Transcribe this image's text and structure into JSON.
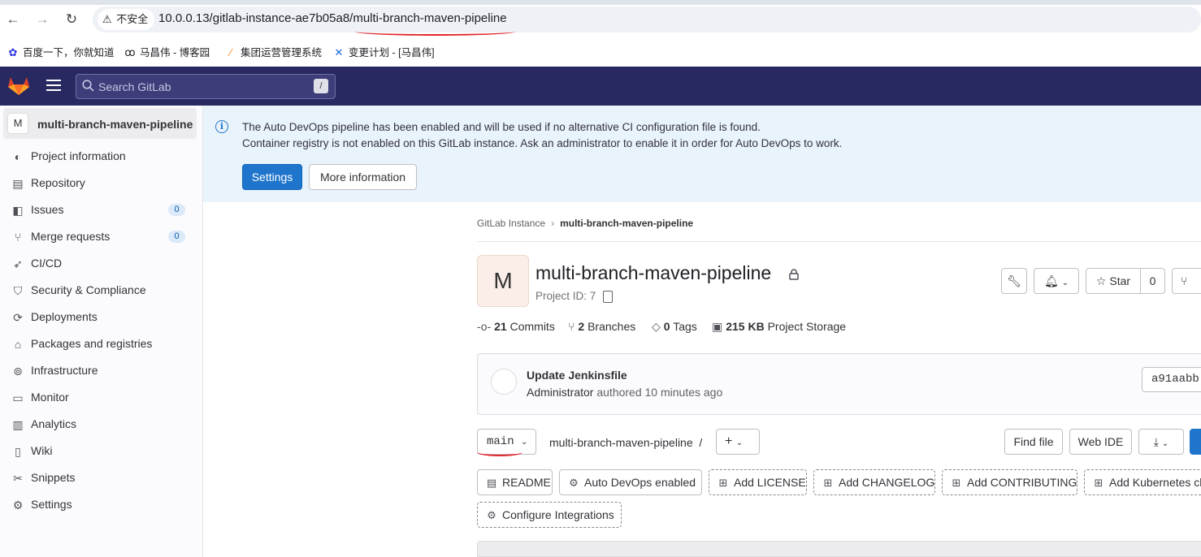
{
  "browser": {
    "insecure_label": "不安全",
    "url": "10.0.0.13/gitlab-instance-ae7b05a8/multi-branch-maven-pipeline",
    "bookmarks": [
      {
        "label": "百度一下，你就知道",
        "icon": "baidu-paw-icon"
      },
      {
        "label": "马昌伟 - 博客园",
        "icon": "blog-icon"
      },
      {
        "label": "集团运营管理系统",
        "icon": "ops-system-icon"
      },
      {
        "label": "变更计划 - [马昌伟]",
        "icon": "confluence-icon"
      }
    ]
  },
  "header": {
    "search_placeholder": "Search GitLab",
    "search_shortcut": "/"
  },
  "sidebar": {
    "project_avatar_letter": "M",
    "project_name": "multi-branch-maven-pipeline",
    "items": [
      {
        "label": "Project information",
        "icon": "project-info-icon"
      },
      {
        "label": "Repository",
        "icon": "document-icon"
      },
      {
        "label": "Issues",
        "icon": "issues-icon",
        "count": "0"
      },
      {
        "label": "Merge requests",
        "icon": "merge-request-icon",
        "count": "0"
      },
      {
        "label": "CI/CD",
        "icon": "rocket-icon"
      },
      {
        "label": "Security & Compliance",
        "icon": "shield-icon"
      },
      {
        "label": "Deployments",
        "icon": "deployments-icon"
      },
      {
        "label": "Packages and registries",
        "icon": "package-icon"
      },
      {
        "label": "Infrastructure",
        "icon": "infrastructure-icon"
      },
      {
        "label": "Monitor",
        "icon": "monitor-icon"
      },
      {
        "label": "Analytics",
        "icon": "chart-icon"
      },
      {
        "label": "Wiki",
        "icon": "book-icon"
      },
      {
        "label": "Snippets",
        "icon": "snippet-icon"
      },
      {
        "label": "Settings",
        "icon": "gear-icon"
      }
    ]
  },
  "alert": {
    "line1": "The Auto DevOps pipeline has been enabled and will be used if no alternative CI configuration file is found.",
    "line2": "Container registry is not enabled on this GitLab instance. Ask an administrator to enable it in order for Auto DevOps to work.",
    "settings_button": "Settings",
    "more_button": "More information"
  },
  "breadcrumb": {
    "parent": "GitLab Instance",
    "current": "multi-branch-maven-pipeline"
  },
  "project": {
    "avatar_letter": "M",
    "title": "multi-branch-maven-pipeline",
    "id_label": "Project ID: 7",
    "star_label": "Star",
    "star_count": "0",
    "stats": {
      "commits_count": "21",
      "commits_label": "Commits",
      "branches_count": "2",
      "branches_label": "Branches",
      "tags_count": "0",
      "tags_label": "Tags",
      "storage_size": "215 KB",
      "storage_label": "Project Storage"
    }
  },
  "last_commit": {
    "title": "Update Jenkinsfile",
    "author": "Administrator",
    "meta": "authored 10 minutes ago",
    "sha": "a91aabb"
  },
  "repo_bar": {
    "branch": "main",
    "path": "multi-branch-maven-pipeline",
    "path_sep": "/",
    "find_file": "Find file",
    "web_ide": "Web IDE"
  },
  "quick_actions": {
    "readme": "README",
    "auto_devops": "Auto DevOps enabled",
    "license": "Add LICENSE",
    "changelog": "Add CHANGELOG",
    "contributing": "Add CONTRIBUTING",
    "kubernetes": "Add Kubernetes cl",
    "integrations": "Configure Integrations"
  },
  "colors": {
    "header_bg": "#292961",
    "primary": "#1f75cb",
    "alert_bg": "#e9f3fc",
    "annotation_red": "#e3262c"
  }
}
